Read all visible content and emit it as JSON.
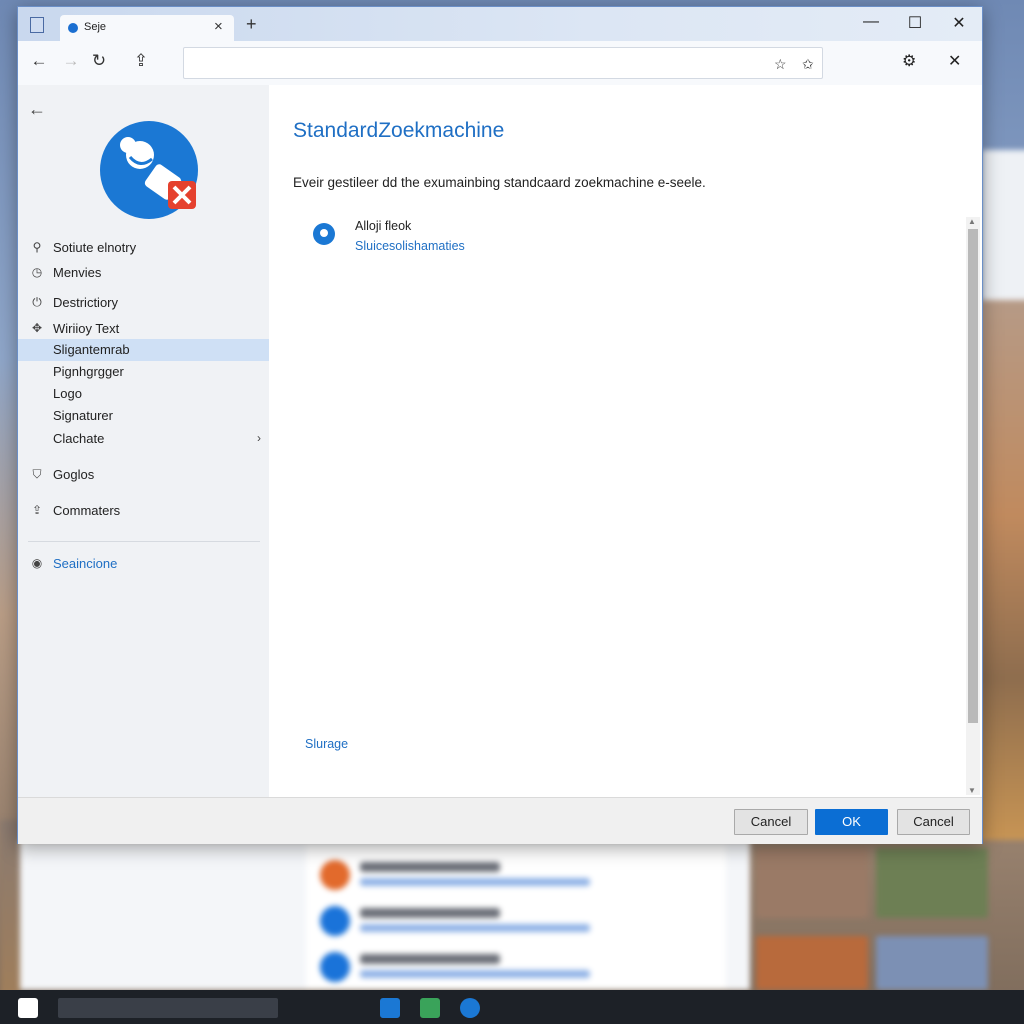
{
  "window": {
    "tab_title": "Sејe",
    "new_tab_symbol": "+",
    "tab_close_symbol": "×",
    "controls": {
      "minimize": "—",
      "maximize": "☐",
      "close": "✕"
    }
  },
  "toolbar": {
    "back": "←",
    "forward": "→",
    "refresh": "↻",
    "home": "⇪",
    "address_value": "",
    "favorite_symbol": "☆",
    "collections_symbol": "✩",
    "extension_symbol": "⚙",
    "close_symbol": "✕"
  },
  "sidebar": {
    "back_symbol": "←",
    "items": [
      {
        "label": "Sotiute elnotry",
        "icon": "profile-icon",
        "glyph": "⚲"
      },
      {
        "label": "Menvies",
        "icon": "clock-icon",
        "glyph": "◷"
      },
      {
        "label": "Destrictiory",
        "icon": "power-icon",
        "glyph": "⏻"
      },
      {
        "label": "Wiriioy Text",
        "icon": "puzzle-icon",
        "glyph": "✥"
      },
      {
        "label": "Sligantemrab",
        "icon": "",
        "glyph": ""
      },
      {
        "label": "Pignhgrgger",
        "icon": "",
        "glyph": ""
      },
      {
        "label": "Logo",
        "icon": "",
        "glyph": ""
      },
      {
        "label": "Signaturer",
        "icon": "",
        "glyph": ""
      },
      {
        "label": "Clachate",
        "icon": "",
        "glyph": "",
        "chevron": "›"
      },
      {
        "label": "Goglos",
        "icon": "shield-icon",
        "glyph": "⛉"
      },
      {
        "label": "Commaters",
        "icon": "share-icon",
        "glyph": "⇪"
      },
      {
        "label": "Seaincione",
        "icon": "search-circle-icon",
        "glyph": "◉"
      }
    ]
  },
  "content": {
    "title": "StandardZoekmachine",
    "description": "Eveir gestileer dd the exumainbing standcaard zoekmachine e-seele.",
    "engine": {
      "name": "Alloji fleok",
      "url": "Sluicesolishamaties"
    },
    "footer_link": "Slurage"
  },
  "footer": {
    "cancel_left": "Cancel",
    "ok": "OK",
    "cancel_right": "Cancel"
  },
  "colors": {
    "accent": "#1f6fc4",
    "primary_button": "#0b6ed4",
    "selected_row": "#cfe0f5"
  }
}
